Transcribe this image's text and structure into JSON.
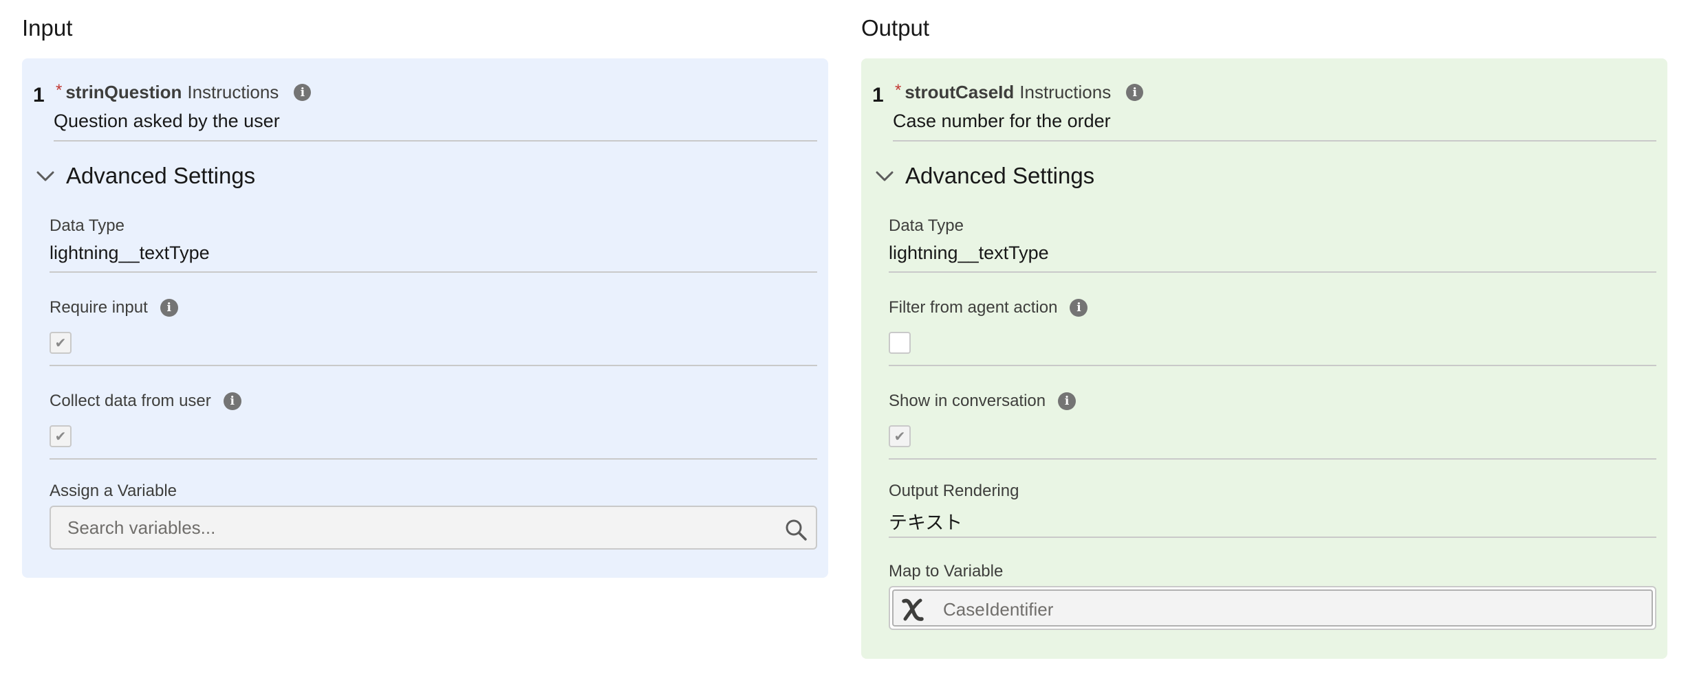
{
  "input": {
    "heading": "Input",
    "row_number": "1",
    "required_marker": "*",
    "param_name": "strinQuestion",
    "instructions_label": "Instructions",
    "instructions_value": "Question asked by the user",
    "advanced_label": "Advanced Settings",
    "data_type_label": "Data Type",
    "data_type_value": "lightning__textType",
    "require_input_label": "Require input",
    "require_input_checked": true,
    "collect_data_label": "Collect data from user",
    "collect_data_checked": true,
    "assign_variable_label": "Assign a Variable",
    "search_placeholder": "Search variables...",
    "panel_color": "#eaf1fd"
  },
  "output": {
    "heading": "Output",
    "row_number": "1",
    "required_marker": "*",
    "param_name": "stroutCaseId",
    "instructions_label": "Instructions",
    "instructions_value": "Case number for the order",
    "advanced_label": "Advanced Settings",
    "data_type_label": "Data Type",
    "data_type_value": "lightning__textType",
    "filter_label": "Filter from agent action",
    "filter_checked": false,
    "show_conversation_label": "Show in conversation",
    "show_conversation_checked": true,
    "output_rendering_label": "Output Rendering",
    "output_rendering_value": "テキスト",
    "map_variable_label": "Map to Variable",
    "map_variable_value": "CaseIdentifier",
    "panel_color": "#e9f5e4"
  },
  "icons": {
    "info": "info-icon",
    "chevron": "chevron-down-icon",
    "search": "search-icon",
    "variable": "variable-icon",
    "check": "checkmark-icon",
    "check_glyph": "✔",
    "info_glyph": "i"
  },
  "colors": {
    "required": "#c23934",
    "info_icon": "#747474"
  }
}
